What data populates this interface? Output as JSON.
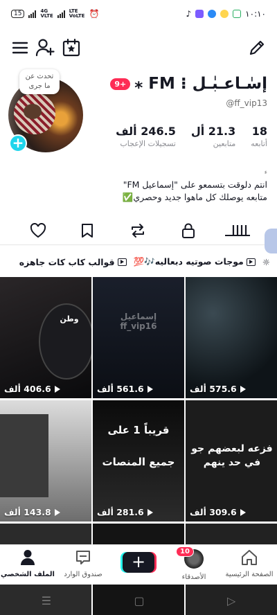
{
  "status_bar": {
    "left_chip": "15",
    "net_label_top": "4G",
    "net_label_bottom": "VLTE",
    "net2_top": "LTE",
    "net2_bottom": "VoLTE",
    "time": "١٠:١٠"
  },
  "top_bar": {
    "icons": [
      "menu-icon",
      "add-friend-icon",
      "calendar-star-icon",
      "edit-icon"
    ]
  },
  "profile": {
    "note_bubble": "تحدث عن ما جرى",
    "notification_count": "9+",
    "display_name": "إسٰـاعـبٰـل ⁝ FM ⁎",
    "handle": "@ff_vip13",
    "stats": [
      {
        "value": "18",
        "label": "أتابعه"
      },
      {
        "value": "21.3 أل",
        "label": "متابعين"
      },
      {
        "value": "246.5 ألف",
        "label": "تسجيلات الإعجاب"
      }
    ],
    "bio_small": "ء",
    "bio_line1": "انتم دلوقت بتسمعو على \"إسماعيل FM\"",
    "bio_line2": "متابعه يوصلك كل ماهوا جديد وحصري✅"
  },
  "tabs": [
    "videos-tab",
    "locked-tab",
    "reposts-tab",
    "favorites-tab",
    "liked-tab"
  ],
  "playlists": [
    {
      "label": "موجات صوتيه دبعاليه🎶💯"
    },
    {
      "label": "قوالب كاب كات جاهزه"
    }
  ],
  "videos": [
    {
      "views": "575.6 ألف",
      "overlay": ""
    },
    {
      "views": "561.6 ألف",
      "overlay": "إسماعيل ff_vip16"
    },
    {
      "views": "406.6 ألف",
      "overlay": "وطن"
    },
    {
      "views": "309.6 ألف",
      "overlay": "فزعه لبعضهم جو في حد ينهم"
    },
    {
      "views": "281.6 ألف",
      "overlay": "قريباً 1 على جميع المنصات"
    },
    {
      "views": "143.8 ألف",
      "overlay": ""
    }
  ],
  "bottom_nav": {
    "home": "الصفحة الرئيسية",
    "friends": "الأصدقاء",
    "friends_badge": "10",
    "create": "+",
    "inbox": "صندوق الوارد",
    "profile": "الملف الشخصي"
  },
  "colors": {
    "accent": "#fe2c55",
    "cyan": "#20d5ec",
    "text": "#161823"
  }
}
